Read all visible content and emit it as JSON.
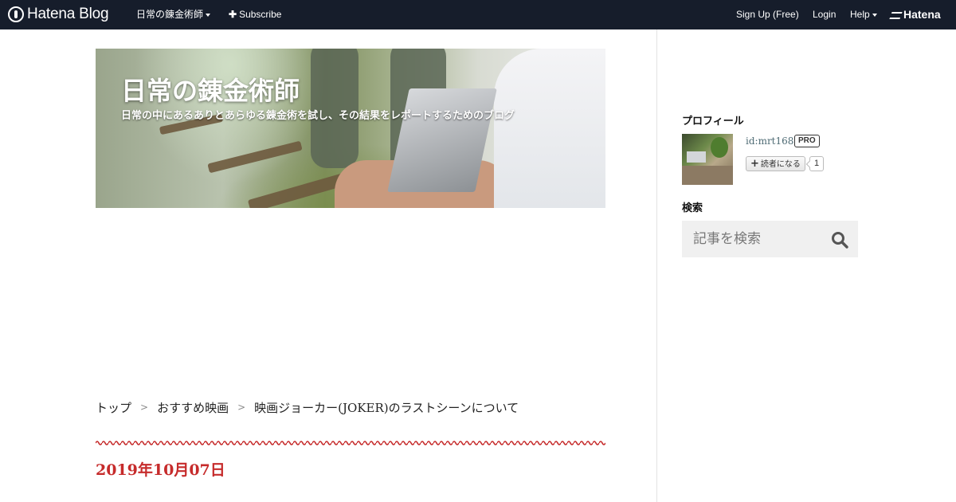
{
  "topbar": {
    "logo_text": "Hatena Blog",
    "blog_name": "日常の錬金術師",
    "subscribe": "Subscribe",
    "signup": "Sign Up (Free)",
    "login": "Login",
    "help": "Help",
    "hatena": "Hatena"
  },
  "header": {
    "title": "日常の錬金術師",
    "description": "日常の中にあるありとあらゆる錬金術を試し、その結果をレポートするためのブログ"
  },
  "breadcrumb": {
    "items": [
      "トップ",
      "おすすめ映画",
      "映画ジョーカー(JOKER)のラストシーンについて"
    ],
    "separator": ">"
  },
  "entry": {
    "date": "2019年10月07日"
  },
  "colors": {
    "topbar_bg": "#161d2b",
    "accent_red": "#c62b2b",
    "search_bg": "#f0f0f0"
  },
  "sidebar": {
    "profile": {
      "title": "プロフィール",
      "id": "id:mrt168",
      "badge": "PRO",
      "reader_button": "読者になる",
      "reader_count": "1"
    },
    "search": {
      "title": "検索",
      "placeholder": "記事を検索",
      "icon": "search-icon"
    }
  }
}
